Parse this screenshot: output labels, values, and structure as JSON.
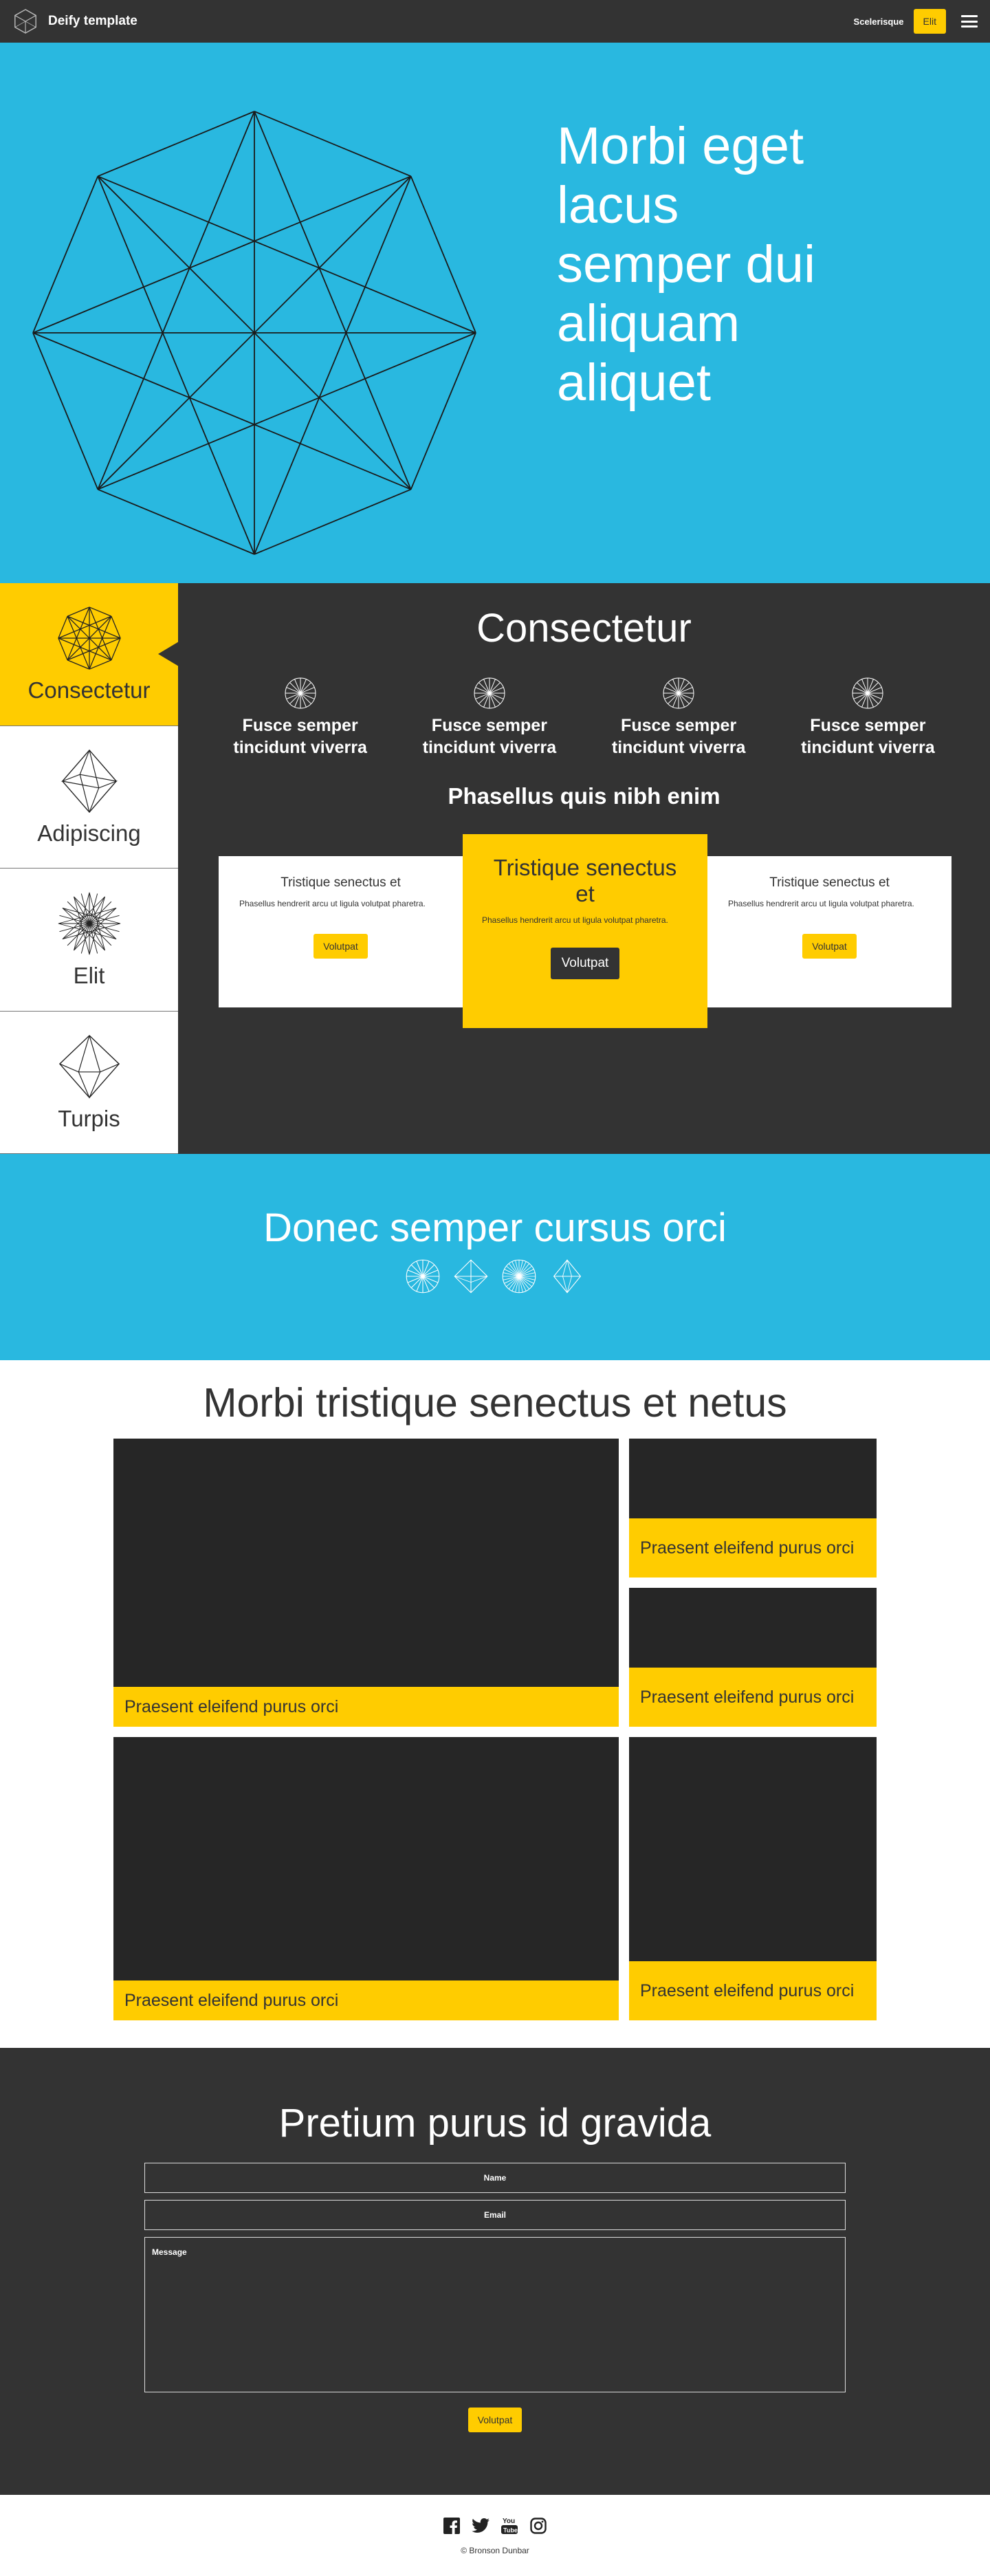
{
  "colors": {
    "accent": "#ffcc00",
    "primary": "#29b8e0",
    "dark": "#333333",
    "panel_dark": "#262626"
  },
  "navbar": {
    "brand": "Deify template",
    "logo_icon": "hexagon-cube-icon",
    "link": "Scelerisque",
    "cta": "Elit",
    "menu_icon": "hamburger-icon"
  },
  "hero": {
    "title": "Morbi eget lacus semper dui aliquam aliquet",
    "art_icon": "geometric-star-polygon"
  },
  "tabs": [
    {
      "label": "Consectetur",
      "icon": "star-polygon-icon",
      "active": true
    },
    {
      "label": "Adipiscing",
      "icon": "octahedron-icon",
      "active": false
    },
    {
      "label": "Elit",
      "icon": "sphere-lines-icon",
      "active": false
    },
    {
      "label": "Turpis",
      "icon": "diamond-icon",
      "active": false
    }
  ],
  "panel": {
    "title": "Consectetur",
    "features": [
      {
        "label": "Fusce semper tincidunt viverra",
        "icon": "wheel-icon"
      },
      {
        "label": "Fusce semper tincidunt viverra",
        "icon": "wheel-icon"
      },
      {
        "label": "Fusce semper tincidunt viverra",
        "icon": "wheel-icon"
      },
      {
        "label": "Fusce semper tincidunt viverra",
        "icon": "wheel-icon"
      }
    ],
    "subtitle": "Phasellus quis nibh enim",
    "cards": {
      "left": {
        "title": "Tristique senectus et",
        "text": "Phasellus hendrerit arcu ut ligula volutpat pharetra.",
        "button": "Volutpat"
      },
      "center": {
        "title": "Tristique senectus et",
        "text": "Phasellus hendrerit arcu ut ligula volutpat pharetra.",
        "button": "Volutpat"
      },
      "right": {
        "title": "Tristique senectus et",
        "text": "Phasellus hendrerit arcu ut ligula volutpat pharetra.",
        "button": "Volutpat"
      }
    }
  },
  "band": {
    "title": "Donec semper cursus orci",
    "icons": [
      "wheel-icon",
      "prism-icon",
      "sphere-icon",
      "diamond-icon"
    ]
  },
  "gallery": {
    "title": "Morbi tristique senectus et netus",
    "items": [
      {
        "caption": "Praesent eleifend purus orci"
      },
      {
        "caption": "Praesent eleifend purus orci"
      },
      {
        "caption": "Praesent eleifend purus orci"
      },
      {
        "caption": "Praesent eleifend purus orci"
      },
      {
        "caption": "Praesent eleifend purus orci"
      }
    ]
  },
  "contact": {
    "title": "Pretium purus id gravida",
    "name_placeholder": "Name",
    "email_placeholder": "Email",
    "message_placeholder": "Message",
    "submit": "Volutpat"
  },
  "footer": {
    "socials": [
      "facebook-icon",
      "twitter-icon",
      "youtube-icon",
      "instagram-icon"
    ],
    "copyright": "© Bronson Dunbar"
  }
}
